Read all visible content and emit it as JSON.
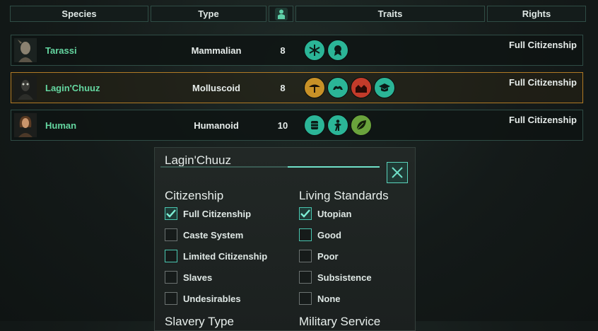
{
  "header": {
    "species": "Species",
    "type": "Type",
    "population_icon": "population-icon",
    "traits": "Traits",
    "rights": "Rights"
  },
  "species": [
    {
      "name": "Tarassi",
      "type": "Mammalian",
      "count": "8",
      "rights": "Full Citizenship",
      "traits": [
        "snowflake-trait-icon",
        "medal-trait-icon"
      ]
    },
    {
      "name": "Lagin'Chuuz",
      "type": "Molluscoid",
      "count": "8",
      "rights": "Full Citizenship",
      "traits": [
        "tree-trait-icon",
        "arms-trait-icon",
        "houses-trait-icon",
        "graduation-cap-trait-icon"
      ]
    },
    {
      "name": "Human",
      "type": "Humanoid",
      "count": "10",
      "rights": "Full Citizenship",
      "traits": [
        "cylinder-trait-icon",
        "runner-trait-icon",
        "leaf-trait-icon"
      ]
    }
  ],
  "colors": {
    "accent": "#5bd3bb",
    "selected_border": "#b07a25",
    "species_name": "#64d6a0",
    "trait_teal": "#2bb597",
    "trait_red": "#c23b2a",
    "trait_amber": "#c89127",
    "trait_green": "#6aa33c"
  },
  "panel": {
    "title": "Lagin'Chuuz",
    "close_icon": "close-icon",
    "citizenship": {
      "title": "Citizenship",
      "options": [
        {
          "label": "Full Citizenship",
          "checked": true
        },
        {
          "label": "Caste System",
          "checked": false
        },
        {
          "label": "Limited Citizenship",
          "checked": false
        },
        {
          "label": "Slaves",
          "checked": false
        },
        {
          "label": "Undesirables",
          "checked": false
        }
      ]
    },
    "living_standards": {
      "title": "Living Standards",
      "options": [
        {
          "label": "Utopian",
          "checked": true
        },
        {
          "label": "Good",
          "checked": false
        },
        {
          "label": "Poor",
          "checked": false
        },
        {
          "label": "Subsistence",
          "checked": false
        },
        {
          "label": "None",
          "checked": false
        }
      ]
    },
    "slavery_type": "Slavery Type",
    "military_service": "Military Service"
  }
}
